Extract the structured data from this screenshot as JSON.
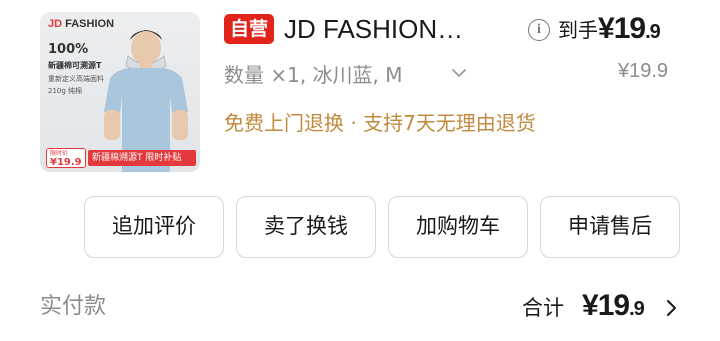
{
  "product": {
    "thumbnail": {
      "brand_jd": "JD",
      "brand_rest": "FASHION",
      "headline": "100%",
      "line1": "新疆棉可溯源T",
      "line2": "重新定义高端面料",
      "line3": "210g 纯棉",
      "tag_small": "限时价",
      "tag_price": "19.9",
      "banner": "新疆棉溯源T 限时补贴"
    },
    "self_operated_badge": "自营",
    "title": "JD FASHION…",
    "to_hand_label": "到手",
    "price_currency": "¥",
    "price_int": "19",
    "price_dec": ".9",
    "original_price": "¥19.9",
    "spec": "数量 ×1, 冰川蓝, M",
    "service_text": "免费上门退换 · 支持7天无理由退货"
  },
  "actions": {
    "review": "追加评价",
    "resell": "卖了换钱",
    "add_cart": "加购物车",
    "after_sales": "申请售后"
  },
  "footer": {
    "paid_label": "实付款",
    "total_label": "合计",
    "total_currency": "¥",
    "total_int": "19",
    "total_dec": ".9"
  },
  "colors": {
    "badge_red": "#e2231a",
    "service_gold": "#c28a3c",
    "muted_gray": "#8c8c8c"
  },
  "icons": [
    "info-icon",
    "chevron-down-icon",
    "chevron-right-icon"
  ]
}
